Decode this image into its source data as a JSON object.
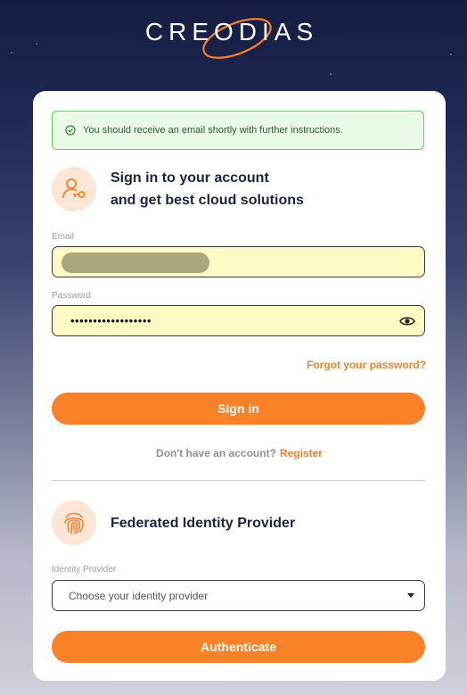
{
  "brand": {
    "name": "CREODIAS",
    "accent": "#f5812a"
  },
  "alert": {
    "message": "You should receive an email shortly with further instructions.",
    "icon": "check-circle-icon"
  },
  "signin": {
    "heading_line1": "Sign in to your account",
    "heading_line2": "and get best cloud solutions",
    "icon": "user-key-icon",
    "email_label": "Email",
    "password_label": "Password",
    "password_value": "••••••••••••••••••",
    "forgot_label": "Forgot your password?",
    "submit_label": "Sign in",
    "no_account_text": "Don't have an account?",
    "register_label": "Register"
  },
  "federated": {
    "heading": "Federated Identity Provider",
    "icon": "fingerprint-icon",
    "provider_label": "Identity Provider",
    "provider_placeholder": "Choose your identity provider",
    "submit_label": "Authenticate"
  }
}
